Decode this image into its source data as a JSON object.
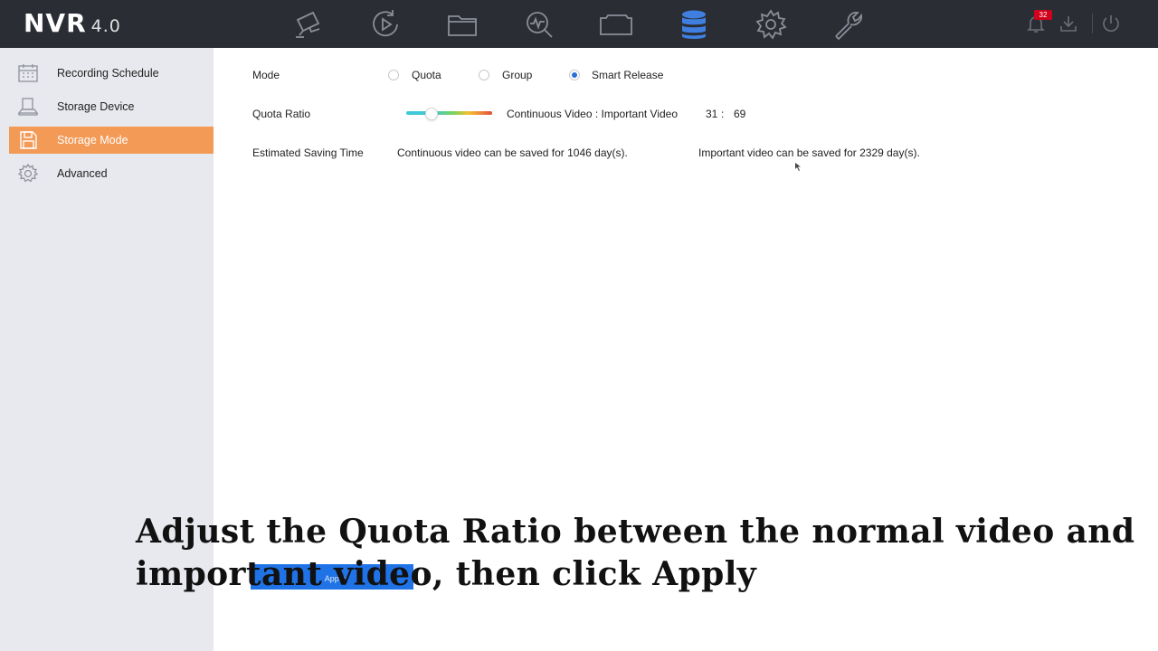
{
  "header": {
    "logo_main": "NVR",
    "logo_version": "4.0",
    "nav_icons": [
      "live-view-camera-icon",
      "playback-icon",
      "file-folder-icon",
      "smart-analysis-icon",
      "video-camera-icon",
      "storage-database-icon",
      "settings-gear-icon",
      "maintenance-wrench-icon"
    ],
    "active_nav": "storage-database-icon",
    "alarm_count": "32"
  },
  "sidebar": {
    "items": [
      {
        "label": "Recording Schedule",
        "icon": "calendar-icon",
        "active": false
      },
      {
        "label": "Storage Device",
        "icon": "hard-disk-icon",
        "active": false
      },
      {
        "label": "Storage Mode",
        "icon": "save-disk-icon",
        "active": true
      },
      {
        "label": "Advanced",
        "icon": "gear-icon",
        "active": false
      }
    ]
  },
  "main": {
    "mode": {
      "label": "Mode",
      "options": [
        {
          "label": "Quota",
          "checked": false
        },
        {
          "label": "Group",
          "checked": false
        },
        {
          "label": "Smart Release",
          "checked": true
        }
      ]
    },
    "quota_ratio": {
      "label": "Quota Ratio",
      "slider_value_percent": 31,
      "ratio_label": "Continuous Video : Important Video",
      "continuous": "31",
      "colon": ":",
      "important": "69"
    },
    "saving_time": {
      "label": "Estimated Saving Time",
      "continuous_text": "Continuous video can be saved for 1046 day(s).",
      "important_text": "Important video can be saved for 2329 day(s)."
    },
    "apply_label": "Apply"
  },
  "overlay": {
    "caption_line1": "Adjust the Quota Ratio between the normal video and",
    "caption_line2": "important video, then click Apply"
  },
  "colors": {
    "topbar": "#2b2d35",
    "sidebar": "#e8e9ee",
    "active_item": "#f29a56",
    "active_nav": "#3f7fe0",
    "radio_checked": "#2a6fd6",
    "highlight": "#1f73e6"
  }
}
